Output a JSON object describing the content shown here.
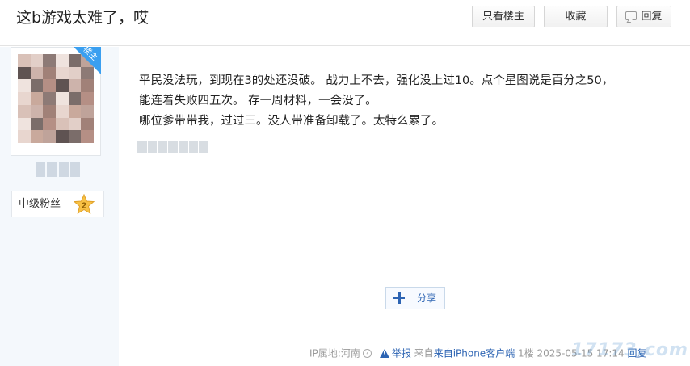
{
  "header": {
    "title": "这b游戏太难了，哎",
    "buttons": {
      "only_op": "只看楼主",
      "favorite": "收藏",
      "reply": "回复"
    }
  },
  "author": {
    "badge": "楼主",
    "fan_level_label": "中级粉丝",
    "fan_level": "2"
  },
  "post": {
    "lines": [
      "平民没法玩，到现在3的处还没破。 战力上不去，强化没上过10。点个星图说是百分之50，",
      "能连着失败四五次。 存一周材料，一会没了。",
      "哪位爹带带我，过过三。没人带准备卸载了。太特么累了。"
    ],
    "share_label": "分享"
  },
  "footer": {
    "ip": "IP属地:河南",
    "help": "?",
    "report": "举报",
    "source": "来自iPhone客户端",
    "floor": "1楼",
    "datetime": "2025-05-15 17:14",
    "reply": "回复"
  },
  "watermark": "17173.com",
  "colors": {
    "link": "#2d64b3",
    "author_bg": "#f4f8fc",
    "badge": "#3a9ff0"
  }
}
